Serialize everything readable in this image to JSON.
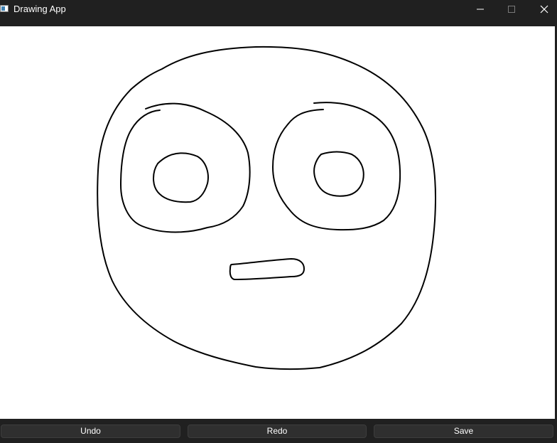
{
  "window": {
    "title": "Drawing App",
    "icon": "app-window-icon",
    "controls": [
      "minimize-icon",
      "maximize-icon",
      "close-icon"
    ]
  },
  "canvas": {
    "background": "#ffffff",
    "stroke_color": "#000000"
  },
  "toolbar": {
    "undo_label": "Undo",
    "redo_label": "Redo",
    "save_label": "Save"
  },
  "colors": {
    "chrome": "#202020",
    "button_bg": "#2f2f2f",
    "text": "#ffffff"
  }
}
